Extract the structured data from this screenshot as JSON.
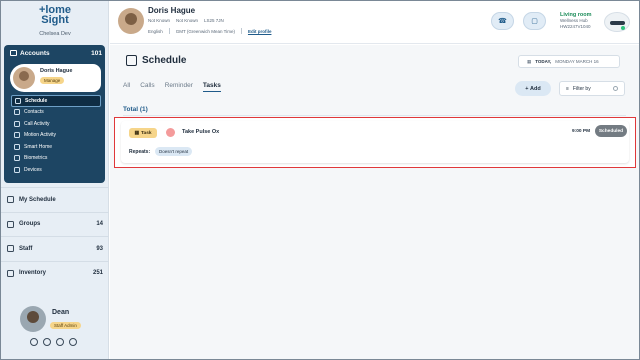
{
  "sidebar": {
    "logo_line1": "+lome",
    "logo_line2": "Sight",
    "org": "Chelsea Dev",
    "accounts_label": "Accounts",
    "accounts_count": "101",
    "profile_name": "Doris Hague",
    "manage_label": "Manage",
    "account_items": [
      {
        "label": "Schedule",
        "icon": "calendar-icon"
      },
      {
        "label": "Contacts",
        "icon": "contacts-icon"
      },
      {
        "label": "Call Activity",
        "icon": "phone-icon"
      },
      {
        "label": "Motion Activity",
        "icon": "motion-icon"
      },
      {
        "label": "Smart Home",
        "icon": "home-icon"
      },
      {
        "label": "Biometrics",
        "icon": "heart-icon"
      },
      {
        "label": "Devices",
        "icon": "device-icon"
      }
    ],
    "nav": [
      {
        "label": "My Schedule",
        "count": ""
      },
      {
        "label": "Groups",
        "count": "14"
      },
      {
        "label": "Staff",
        "count": "93"
      },
      {
        "label": "Inventory",
        "count": "251"
      }
    ],
    "user_name": "Dean",
    "user_role": "Staff Admin"
  },
  "header": {
    "patient_name": "Doris Hague",
    "meta1": "Not Known",
    "meta2": "Not Known",
    "meta3": "LS25 7JN",
    "language": "English",
    "timezone": "GMT (Greenwich Mean Time)",
    "edit_label": "Edit profile",
    "device_room": "Living room",
    "device_model": "Wellness Hub",
    "device_id": "HW2247V1040"
  },
  "main": {
    "title": "Schedule",
    "date_prefix": "TODAY,",
    "date_value": "MONDAY MARCH 16",
    "tabs": [
      "All",
      "Calls",
      "Reminder",
      "Tasks"
    ],
    "active_tab": "Tasks",
    "add_label": "Add",
    "filter_label": "Filter by",
    "total_label": "Total (1)",
    "task": {
      "type_label": "Task",
      "name": "Take Pulse Ox",
      "time": "9:00 PM",
      "status": "Scheduled",
      "repeats_label": "Repeats:",
      "repeats_value": "Doesn't repeat"
    }
  }
}
